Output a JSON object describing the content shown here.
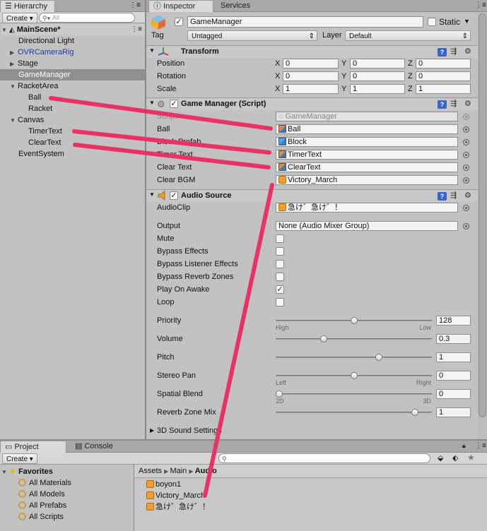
{
  "hierarchy": {
    "tab": "Hierarchy",
    "create": "Create",
    "search_placeholder": "All",
    "scene": "MainScene*",
    "items": [
      {
        "label": "Directional Light"
      },
      {
        "label": "OVRCameraRig"
      },
      {
        "label": "Stage"
      },
      {
        "label": "GameManager"
      },
      {
        "label": "RacketArea"
      },
      {
        "label": "Ball"
      },
      {
        "label": "Racket"
      },
      {
        "label": "Canvas"
      },
      {
        "label": "TimerText"
      },
      {
        "label": "ClearText"
      },
      {
        "label": "EventSystem"
      }
    ]
  },
  "inspector": {
    "tabs": [
      "Inspector",
      "Services"
    ],
    "object_name": "GameManager",
    "static_label": "Static",
    "tag_label": "Tag",
    "tag_value": "Untagged",
    "layer_label": "Layer",
    "layer_value": "Default",
    "transform": {
      "title": "Transform",
      "rows": [
        {
          "label": "Position",
          "x": "0",
          "y": "0",
          "z": "0"
        },
        {
          "label": "Rotation",
          "x": "0",
          "y": "0",
          "z": "0"
        },
        {
          "label": "Scale",
          "x": "1",
          "y": "1",
          "z": "1"
        }
      ]
    },
    "game_manager": {
      "title": "Game Manager (Script)",
      "rows": [
        {
          "label": "Script",
          "value": "GameManager"
        },
        {
          "label": "Ball",
          "value": "Ball"
        },
        {
          "label": "Block Prefab",
          "value": "Block"
        },
        {
          "label": "Timer Text",
          "value": "TimerText"
        },
        {
          "label": "Clear Text",
          "value": "ClearText"
        },
        {
          "label": "Clear BGM",
          "value": "Victory_March"
        }
      ]
    },
    "audio_source": {
      "title": "Audio Source",
      "audioclip_label": "AudioClip",
      "audioclip_value": "急け゛急け゛！",
      "output_label": "Output",
      "output_value": "None (Audio Mixer Group)",
      "checks": [
        {
          "label": "Mute",
          "checked": false
        },
        {
          "label": "Bypass Effects",
          "checked": false
        },
        {
          "label": "Bypass Listener Effects",
          "checked": false
        },
        {
          "label": "Bypass Reverb Zones",
          "checked": false
        },
        {
          "label": "Play On Awake",
          "checked": true
        },
        {
          "label": "Loop",
          "checked": false
        }
      ],
      "sliders": [
        {
          "label": "Priority",
          "value": "128",
          "fraction": 0.5,
          "left": "High",
          "right": "Low"
        },
        {
          "label": "Volume",
          "value": "0.3",
          "fraction": 0.3,
          "left": "",
          "right": ""
        },
        {
          "label": "Pitch",
          "value": "1",
          "fraction": 0.67,
          "left": "",
          "right": ""
        },
        {
          "label": "Stereo Pan",
          "value": "0",
          "fraction": 0.5,
          "left": "Left",
          "right": "Right"
        },
        {
          "label": "Spatial Blend",
          "value": "0",
          "fraction": 0.0,
          "left": "2D",
          "right": "3D"
        },
        {
          "label": "Reverb Zone Mix",
          "value": "1",
          "fraction": 0.91,
          "left": "",
          "right": ""
        }
      ],
      "sound_settings": "3D Sound Settings"
    }
  },
  "project": {
    "tabs": [
      "Project",
      "Console"
    ],
    "create": "Create",
    "favorites_title": "Favorites",
    "favorites": [
      "All Materials",
      "All Models",
      "All Prefabs",
      "All Scripts"
    ],
    "breadcrumb": [
      "Assets",
      "Main",
      "Audio"
    ],
    "files": [
      "boyon1",
      "Victory_March",
      "急け゛急け゛！"
    ]
  },
  "colors": {
    "annotation": "#e83368",
    "selection": "#8f8f8f",
    "link_blue": "#1a3fa3"
  }
}
